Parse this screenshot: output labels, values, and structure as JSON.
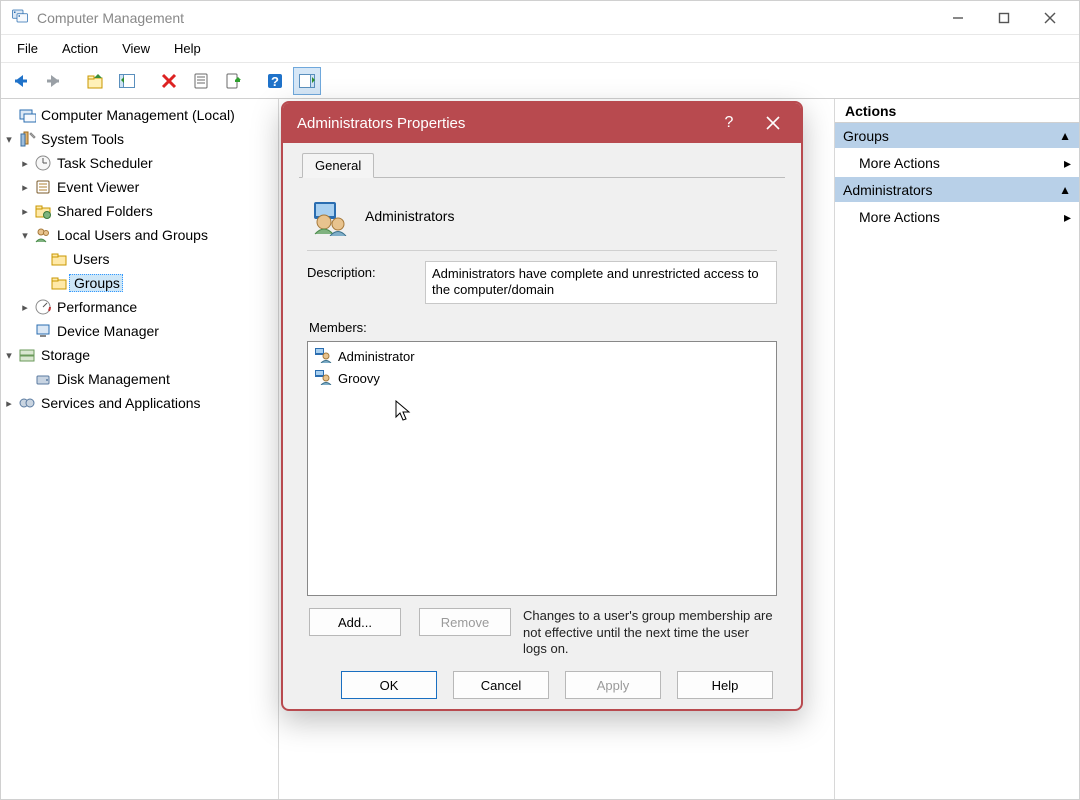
{
  "window": {
    "title": "Computer Management"
  },
  "menu": {
    "file": "File",
    "action": "Action",
    "view": "View",
    "help": "Help"
  },
  "tree": {
    "root": "Computer Management (Local)",
    "systemTools": "System Tools",
    "taskScheduler": "Task Scheduler",
    "eventViewer": "Event Viewer",
    "sharedFolders": "Shared Folders",
    "localUsers": "Local Users and Groups",
    "users": "Users",
    "groups": "Groups",
    "performance": "Performance",
    "deviceManager": "Device Manager",
    "storage": "Storage",
    "diskManagement": "Disk Management",
    "servicesApps": "Services and Applications"
  },
  "actions": {
    "header": "Actions",
    "section1": "Groups",
    "item1": "More Actions",
    "section2": "Administrators",
    "item2": "More Actions"
  },
  "dialog": {
    "title": "Administrators Properties",
    "tab_general": "General",
    "group_name": "Administrators",
    "description_label": "Description:",
    "description_value": "Administrators have complete and unrestricted access to the computer/domain",
    "members_label": "Members:",
    "members": {
      "0": "Administrator",
      "1": "Groovy"
    },
    "note": "Changes to a user's group membership are not effective until the next time the user logs on.",
    "buttons": {
      "add": "Add...",
      "remove": "Remove",
      "ok": "OK",
      "cancel": "Cancel",
      "apply": "Apply",
      "help": "Help"
    }
  }
}
